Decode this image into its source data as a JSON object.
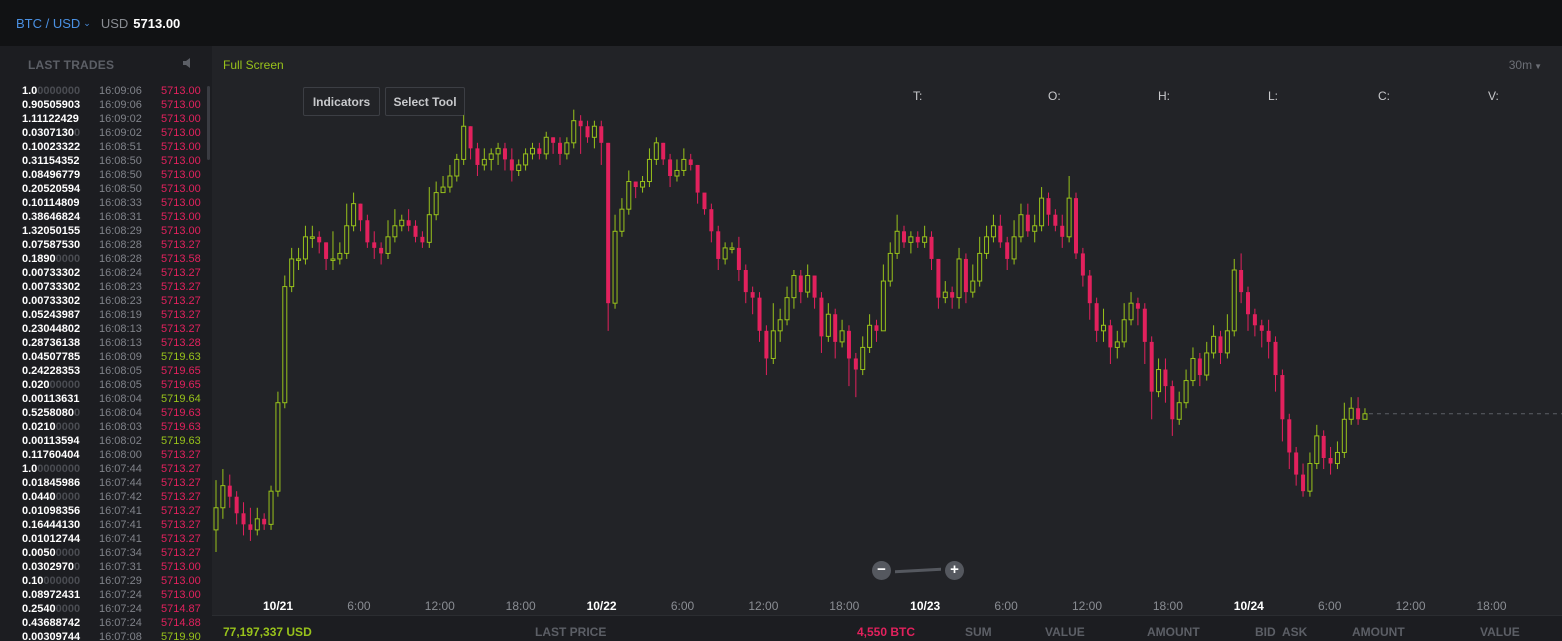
{
  "topbar": {
    "pair": "BTC / USD",
    "currency": "USD",
    "price": "5713.00"
  },
  "last_trades": {
    "title": "LAST TRADES",
    "rows": [
      {
        "a": "1.0",
        "d": "0000000",
        "t": "16:09:06",
        "p": "5713.00",
        "s": "dn"
      },
      {
        "a": "0.90505903",
        "d": "",
        "t": "16:09:06",
        "p": "5713.00",
        "s": "dn"
      },
      {
        "a": "1.11122429",
        "d": "",
        "t": "16:09:02",
        "p": "5713.00",
        "s": "dn"
      },
      {
        "a": "0.0307130",
        "d": "0",
        "t": "16:09:02",
        "p": "5713.00",
        "s": "dn"
      },
      {
        "a": "0.10023322",
        "d": "",
        "t": "16:08:51",
        "p": "5713.00",
        "s": "dn"
      },
      {
        "a": "0.31154352",
        "d": "",
        "t": "16:08:50",
        "p": "5713.00",
        "s": "dn"
      },
      {
        "a": "0.08496779",
        "d": "",
        "t": "16:08:50",
        "p": "5713.00",
        "s": "dn"
      },
      {
        "a": "0.20520594",
        "d": "",
        "t": "16:08:50",
        "p": "5713.00",
        "s": "dn"
      },
      {
        "a": "0.10114809",
        "d": "",
        "t": "16:08:33",
        "p": "5713.00",
        "s": "dn"
      },
      {
        "a": "0.38646824",
        "d": "",
        "t": "16:08:31",
        "p": "5713.00",
        "s": "dn"
      },
      {
        "a": "1.32050155",
        "d": "",
        "t": "16:08:29",
        "p": "5713.00",
        "s": "dn"
      },
      {
        "a": "0.07587530",
        "d": "",
        "t": "16:08:28",
        "p": "5713.27",
        "s": "dn"
      },
      {
        "a": "0.1890",
        "d": "0000",
        "t": "16:08:28",
        "p": "5713.58",
        "s": "dn"
      },
      {
        "a": "0.00733302",
        "d": "",
        "t": "16:08:24",
        "p": "5713.27",
        "s": "dn"
      },
      {
        "a": "0.00733302",
        "d": "",
        "t": "16:08:23",
        "p": "5713.27",
        "s": "dn"
      },
      {
        "a": "0.00733302",
        "d": "",
        "t": "16:08:23",
        "p": "5713.27",
        "s": "dn"
      },
      {
        "a": "0.05243987",
        "d": "",
        "t": "16:08:19",
        "p": "5713.27",
        "s": "dn"
      },
      {
        "a": "0.23044802",
        "d": "",
        "t": "16:08:13",
        "p": "5713.27",
        "s": "dn"
      },
      {
        "a": "0.28736138",
        "d": "",
        "t": "16:08:13",
        "p": "5713.28",
        "s": "dn"
      },
      {
        "a": "0.04507785",
        "d": "",
        "t": "16:08:09",
        "p": "5719.63",
        "s": "up"
      },
      {
        "a": "0.24228353",
        "d": "",
        "t": "16:08:05",
        "p": "5719.65",
        "s": "dn"
      },
      {
        "a": "0.020",
        "d": "00000",
        "t": "16:08:05",
        "p": "5719.65",
        "s": "dn"
      },
      {
        "a": "0.00113631",
        "d": "",
        "t": "16:08:04",
        "p": "5719.64",
        "s": "up"
      },
      {
        "a": "0.5258080",
        "d": "0",
        "t": "16:08:04",
        "p": "5719.63",
        "s": "dn"
      },
      {
        "a": "0.0210",
        "d": "0000",
        "t": "16:08:03",
        "p": "5719.63",
        "s": "dn"
      },
      {
        "a": "0.00113594",
        "d": "",
        "t": "16:08:02",
        "p": "5719.63",
        "s": "up"
      },
      {
        "a": "0.11760404",
        "d": "",
        "t": "16:08:00",
        "p": "5713.27",
        "s": "dn"
      },
      {
        "a": "1.0",
        "d": "0000000",
        "t": "16:07:44",
        "p": "5713.27",
        "s": "dn"
      },
      {
        "a": "0.01845986",
        "d": "",
        "t": "16:07:44",
        "p": "5713.27",
        "s": "dn"
      },
      {
        "a": "0.0440",
        "d": "0000",
        "t": "16:07:42",
        "p": "5713.27",
        "s": "dn"
      },
      {
        "a": "0.01098356",
        "d": "",
        "t": "16:07:41",
        "p": "5713.27",
        "s": "dn"
      },
      {
        "a": "0.16444130",
        "d": "",
        "t": "16:07:41",
        "p": "5713.27",
        "s": "dn"
      },
      {
        "a": "0.01012744",
        "d": "",
        "t": "16:07:41",
        "p": "5713.27",
        "s": "dn"
      },
      {
        "a": "0.0050",
        "d": "0000",
        "t": "16:07:34",
        "p": "5713.27",
        "s": "dn"
      },
      {
        "a": "0.0302970",
        "d": "0",
        "t": "16:07:31",
        "p": "5713.00",
        "s": "dn"
      },
      {
        "a": "0.10",
        "d": "000000",
        "t": "16:07:29",
        "p": "5713.00",
        "s": "dn"
      },
      {
        "a": "0.08972431",
        "d": "",
        "t": "16:07:24",
        "p": "5713.00",
        "s": "dn"
      },
      {
        "a": "0.2540",
        "d": "0000",
        "t": "16:07:24",
        "p": "5714.87",
        "s": "dn"
      },
      {
        "a": "0.43688742",
        "d": "",
        "t": "16:07:24",
        "p": "5714.88",
        "s": "dn"
      },
      {
        "a": "0.00309744",
        "d": "",
        "t": "16:07:08",
        "p": "5719.90",
        "s": "up"
      }
    ]
  },
  "chart": {
    "fullscreen_label": "Full Screen",
    "interval": "30m",
    "indicators_label": "Indicators",
    "select_tool_label": "Select Tool",
    "ohlc_labels": [
      "T:",
      "O:",
      "H:",
      "L:",
      "C:",
      "V:"
    ],
    "x_labels": [
      {
        "text": "10/21",
        "day": true
      },
      {
        "text": "6:00",
        "day": false
      },
      {
        "text": "12:00",
        "day": false
      },
      {
        "text": "18:00",
        "day": false
      },
      {
        "text": "10/22",
        "day": true
      },
      {
        "text": "6:00",
        "day": false
      },
      {
        "text": "12:00",
        "day": false
      },
      {
        "text": "18:00",
        "day": false
      },
      {
        "text": "10/23",
        "day": true
      },
      {
        "text": "6:00",
        "day": false
      },
      {
        "text": "12:00",
        "day": false
      },
      {
        "text": "18:00",
        "day": false
      },
      {
        "text": "10/24",
        "day": true
      },
      {
        "text": "6:00",
        "day": false
      },
      {
        "text": "12:00",
        "day": false
      },
      {
        "text": "18:00",
        "day": false
      }
    ],
    "up_color": "#98c21b",
    "down_color": "#e2215d"
  },
  "bottom_bar": {
    "volume_usd": "77,197,337 USD",
    "last_price_label": "LAST PRICE",
    "volume_btc": "4,550 BTC",
    "sum_label": "SUM",
    "value_label": "VALUE",
    "amount_label": "AMOUNT",
    "bid_label": "BID",
    "ask_label": "ASK",
    "amount2_label": "AMOUNT",
    "value2_label": "VALUE"
  },
  "chart_data": {
    "type": "candlestick",
    "interval": "30m",
    "x_ticks": [
      "10/21",
      "6:00",
      "12:00",
      "18:00",
      "10/22",
      "6:00",
      "12:00",
      "18:00",
      "10/23",
      "6:00",
      "12:00",
      "18:00",
      "10/24",
      "6:00",
      "12:00",
      "18:00"
    ],
    "candles": [
      [
        84,
        88,
        93,
        80
      ],
      [
        88,
        92,
        95,
        86
      ],
      [
        92,
        90,
        94,
        88
      ],
      [
        90,
        87,
        91,
        85
      ],
      [
        87,
        85,
        89,
        83
      ],
      [
        85,
        84,
        88,
        82
      ],
      [
        84,
        86,
        88,
        83
      ],
      [
        86,
        85,
        87,
        84
      ],
      [
        85,
        91,
        92,
        84
      ],
      [
        91,
        107,
        109,
        90
      ],
      [
        107,
        128,
        130,
        106
      ],
      [
        128,
        133,
        135,
        127
      ],
      [
        133,
        133,
        135,
        131
      ],
      [
        133,
        137,
        139,
        132
      ],
      [
        137,
        137,
        139,
        135
      ],
      [
        137,
        136,
        138,
        134
      ],
      [
        136,
        133,
        136,
        131
      ],
      [
        133,
        133,
        138,
        131
      ],
      [
        133,
        134,
        136,
        132
      ],
      [
        134,
        139,
        143,
        133
      ],
      [
        139,
        143,
        145,
        138
      ],
      [
        143,
        140,
        143,
        138
      ],
      [
        140,
        136,
        141,
        135
      ],
      [
        136,
        135,
        138,
        133
      ],
      [
        135,
        134,
        136,
        132
      ],
      [
        134,
        137,
        140,
        133
      ],
      [
        137,
        139,
        142,
        136
      ],
      [
        139,
        140,
        141,
        138
      ],
      [
        140,
        139,
        142,
        138
      ],
      [
        139,
        137,
        140,
        136
      ],
      [
        137,
        136,
        138,
        135
      ],
      [
        136,
        141,
        146,
        135
      ],
      [
        141,
        145,
        147,
        140
      ],
      [
        145,
        146,
        148,
        145
      ],
      [
        146,
        148,
        150,
        145
      ],
      [
        148,
        151,
        152,
        147
      ],
      [
        151,
        157,
        159,
        150
      ],
      [
        157,
        153,
        157,
        151
      ],
      [
        153,
        150,
        154,
        148
      ],
      [
        150,
        151,
        153,
        149
      ],
      [
        151,
        152,
        153,
        149
      ],
      [
        152,
        153,
        154,
        150
      ],
      [
        153,
        151,
        154,
        149
      ],
      [
        151,
        149,
        153,
        147
      ],
      [
        149,
        150,
        151,
        148
      ],
      [
        150,
        152,
        153,
        149
      ],
      [
        152,
        153,
        154,
        151
      ],
      [
        153,
        152,
        154,
        151
      ],
      [
        152,
        155,
        156,
        151
      ],
      [
        155,
        154,
        155,
        152
      ],
      [
        154,
        152,
        155,
        150
      ],
      [
        152,
        154,
        155,
        151
      ],
      [
        154,
        158,
        160,
        153
      ],
      [
        158,
        157,
        159,
        152
      ],
      [
        157,
        155,
        158,
        154
      ],
      [
        155,
        157,
        158,
        153
      ],
      [
        157,
        154,
        158,
        150
      ],
      [
        154,
        125,
        154,
        120
      ],
      [
        125,
        138,
        141,
        124
      ],
      [
        138,
        142,
        144,
        137
      ],
      [
        142,
        147,
        149,
        141
      ],
      [
        147,
        146,
        147,
        144
      ],
      [
        146,
        147,
        148,
        145
      ],
      [
        147,
        151,
        153,
        146
      ],
      [
        151,
        154,
        155,
        150
      ],
      [
        154,
        151,
        154,
        150
      ],
      [
        151,
        148,
        152,
        146
      ],
      [
        148,
        149,
        151,
        147
      ],
      [
        149,
        151,
        153,
        148
      ],
      [
        151,
        150,
        152,
        149
      ],
      [
        150,
        145,
        150,
        143
      ],
      [
        145,
        142,
        144,
        141
      ],
      [
        142,
        138,
        143,
        136
      ],
      [
        138,
        133,
        139,
        131
      ],
      [
        133,
        135,
        136,
        132
      ],
      [
        135,
        135,
        136,
        134
      ],
      [
        135,
        131,
        137,
        129
      ],
      [
        131,
        127,
        132,
        125
      ],
      [
        127,
        126,
        128,
        123
      ],
      [
        126,
        120,
        127,
        118
      ],
      [
        120,
        115,
        121,
        112
      ],
      [
        115,
        120,
        125,
        114
      ],
      [
        120,
        122,
        124,
        118
      ],
      [
        122,
        126,
        128,
        121
      ],
      [
        126,
        130,
        131,
        124
      ],
      [
        130,
        127,
        131,
        125
      ],
      [
        127,
        130,
        132,
        126
      ],
      [
        130,
        126,
        130,
        124
      ],
      [
        126,
        119,
        127,
        116
      ],
      [
        119,
        123,
        125,
        118
      ],
      [
        123,
        118,
        124,
        115
      ],
      [
        118,
        120,
        122,
        117
      ],
      [
        120,
        115,
        121,
        110
      ],
      [
        115,
        113,
        116,
        108
      ],
      [
        113,
        117,
        119,
        112
      ],
      [
        117,
        121,
        123,
        116
      ],
      [
        121,
        120,
        122,
        118
      ],
      [
        120,
        129,
        132,
        120
      ],
      [
        129,
        134,
        136,
        128
      ],
      [
        134,
        138,
        141,
        133
      ],
      [
        138,
        136,
        139,
        135
      ],
      [
        136,
        137,
        138,
        134
      ],
      [
        137,
        136,
        138,
        135
      ],
      [
        136,
        137,
        139,
        135
      ],
      [
        137,
        133,
        138,
        131
      ],
      [
        133,
        126,
        133,
        124
      ],
      [
        126,
        127,
        129,
        125
      ],
      [
        127,
        126,
        128,
        124
      ],
      [
        126,
        133,
        135,
        124
      ],
      [
        133,
        127,
        134,
        125
      ],
      [
        127,
        129,
        132,
        126
      ],
      [
        129,
        134,
        137,
        128
      ],
      [
        134,
        137,
        139,
        133
      ],
      [
        137,
        139,
        141,
        136
      ],
      [
        139,
        136,
        141,
        135
      ],
      [
        136,
        133,
        137,
        131
      ],
      [
        133,
        137,
        140,
        132
      ],
      [
        137,
        141,
        143,
        136
      ],
      [
        141,
        138,
        143,
        137
      ],
      [
        138,
        139,
        141,
        136
      ],
      [
        139,
        144,
        146,
        138
      ],
      [
        144,
        141,
        145,
        139
      ],
      [
        141,
        139,
        142,
        138
      ],
      [
        139,
        137,
        141,
        135
      ],
      [
        137,
        144,
        148,
        136
      ],
      [
        144,
        134,
        145,
        133
      ],
      [
        134,
        130,
        135,
        128
      ],
      [
        130,
        125,
        131,
        122
      ],
      [
        125,
        120,
        126,
        118
      ],
      [
        120,
        121,
        124,
        118
      ],
      [
        121,
        117,
        122,
        114
      ],
      [
        117,
        118,
        120,
        115
      ],
      [
        118,
        122,
        125,
        117
      ],
      [
        122,
        125,
        127,
        121
      ],
      [
        125,
        124,
        126,
        121
      ],
      [
        124,
        118,
        125,
        114
      ],
      [
        118,
        109,
        119,
        104
      ],
      [
        109,
        113,
        115,
        108
      ],
      [
        113,
        110,
        115,
        107
      ],
      [
        110,
        104,
        111,
        101
      ],
      [
        104,
        107,
        109,
        103
      ],
      [
        107,
        111,
        113,
        106
      ],
      [
        111,
        115,
        117,
        110
      ],
      [
        115,
        112,
        116,
        110
      ],
      [
        112,
        116,
        118,
        111
      ],
      [
        116,
        119,
        121,
        115
      ],
      [
        119,
        116,
        120,
        114
      ],
      [
        116,
        120,
        123,
        115
      ],
      [
        120,
        131,
        133,
        119
      ],
      [
        131,
        127,
        134,
        125
      ],
      [
        127,
        123,
        128,
        120
      ],
      [
        123,
        121,
        124,
        119
      ],
      [
        121,
        120,
        122,
        117
      ],
      [
        120,
        118,
        122,
        115
      ],
      [
        118,
        112,
        119,
        109
      ],
      [
        112,
        104,
        113,
        100
      ],
      [
        104,
        98,
        105,
        95
      ],
      [
        98,
        94,
        99,
        92
      ],
      [
        94,
        91,
        96,
        90
      ],
      [
        91,
        96,
        98,
        90
      ],
      [
        96,
        101,
        103,
        95
      ],
      [
        101,
        97,
        102,
        95
      ],
      [
        97,
        96,
        99,
        94
      ],
      [
        96,
        98,
        100,
        95
      ],
      [
        98,
        104,
        107,
        97
      ],
      [
        104,
        106,
        108,
        103
      ],
      [
        106,
        104,
        108,
        103
      ],
      [
        104,
        105,
        106,
        104
      ]
    ]
  }
}
